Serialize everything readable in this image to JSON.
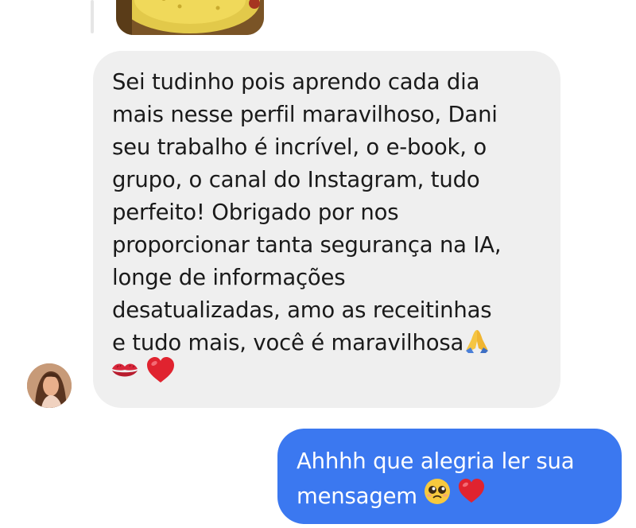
{
  "conversation": {
    "shared_media": {
      "icon": "food-photo-thumbnail"
    },
    "received_message": {
      "sender_avatar": "avatar-photo",
      "lines": [
        "Sei tudinho pois aprendo cada dia",
        "mais nesse perfil maravilhoso, Dani",
        "seu trabalho é incrível, o e-book, o",
        "grupo, o canal do Instagram, tudo",
        "perfeito! Obrigado por nos",
        "proporcionar tanta segurança na IA,",
        "longe de informações",
        "desatualizadas, amo as receitinhas",
        "e tudo mais, você é maravilhosa"
      ],
      "emojis": [
        "folded-hands-icon",
        "kiss-mark-icon",
        "red-heart-icon"
      ]
    },
    "sent_message": {
      "line1": "Ahhhh que alegria ler sua",
      "line2": "mensagem",
      "emojis": [
        "pleading-face-icon",
        "red-heart-icon"
      ]
    }
  },
  "colors": {
    "received_bubble": "#efefef",
    "sent_bubble": "#3b78f0",
    "received_text": "#1a1a1a",
    "sent_text": "#ffffff"
  }
}
